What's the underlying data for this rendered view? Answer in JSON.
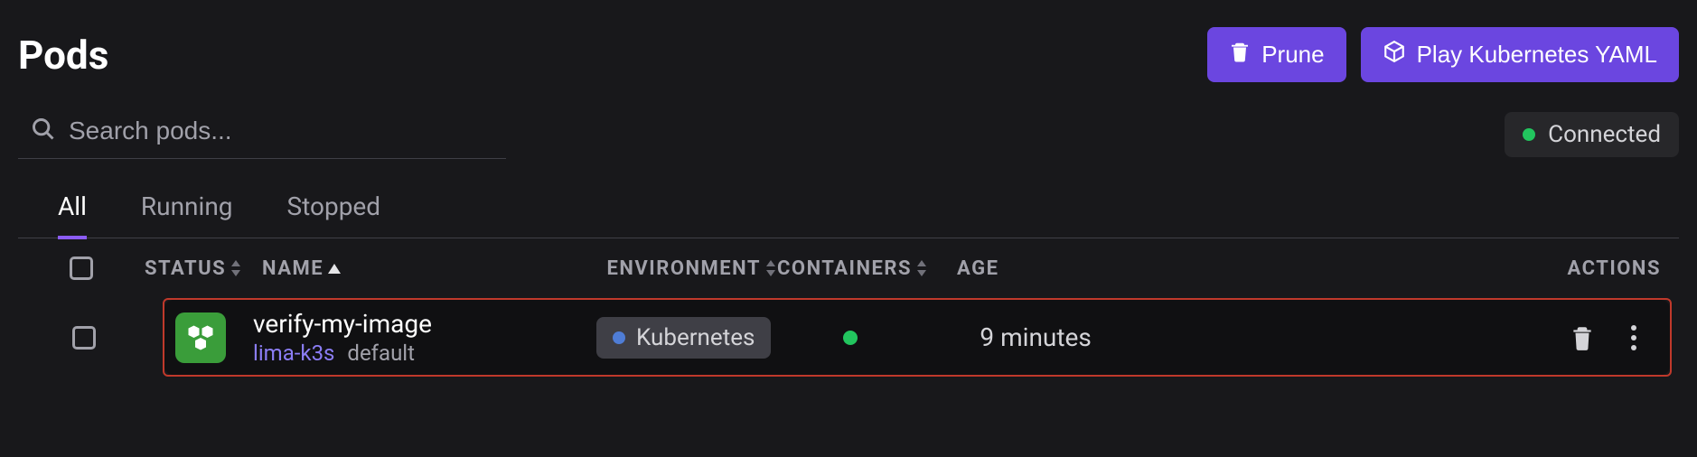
{
  "header": {
    "title": "Pods",
    "prune_label": "Prune",
    "play_yaml_label": "Play Kubernetes YAML"
  },
  "search": {
    "placeholder": "Search pods..."
  },
  "connection": {
    "status_label": "Connected",
    "status_color": "#22c55e"
  },
  "tabs": [
    {
      "label": "All",
      "active": true
    },
    {
      "label": "Running",
      "active": false
    },
    {
      "label": "Stopped",
      "active": false
    }
  ],
  "columns": {
    "status": "STATUS",
    "name": "NAME",
    "environment": "ENVIRONMENT",
    "containers": "CONTAINERS",
    "age": "AGE",
    "actions": "ACTIONS"
  },
  "rows": [
    {
      "name": "verify-my-image",
      "cluster": "lima-k3s",
      "namespace": "default",
      "environment": "Kubernetes",
      "container_status_color": "#22c55e",
      "age": "9 minutes"
    }
  ]
}
